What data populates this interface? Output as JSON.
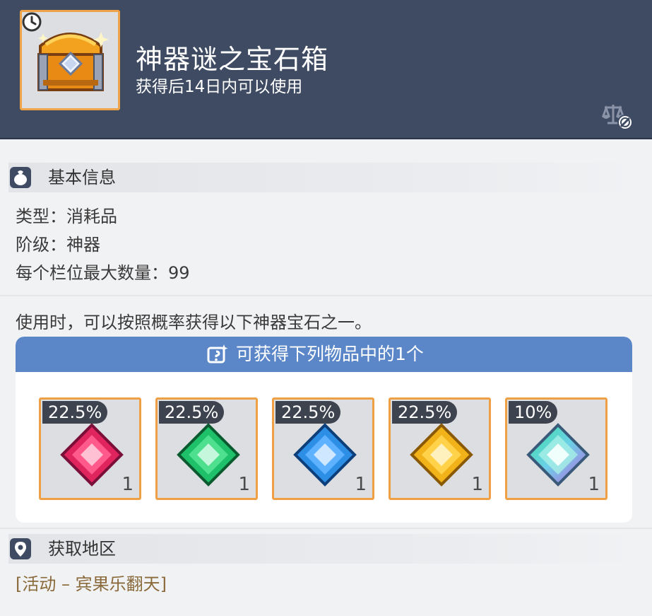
{
  "item": {
    "name": "神器谜之宝石箱",
    "expiry": "获得后14日内可以使用",
    "icon": "treasure-chest-icon",
    "badge_icon": "clock-icon",
    "trade_status_icon": "untradeable-scale-icon"
  },
  "basic_info": {
    "title": "基本信息",
    "icon": "money-bag-icon",
    "type_line": "类型：消耗品",
    "grade_line": "阶级：神器",
    "max_stack_line": "每个栏位最大数量：99"
  },
  "description": "使用时，可以按照概率获得以下神器宝石之一。",
  "rewards": {
    "title": "可获得下列物品中的1个",
    "icon": "random-box-icon",
    "items": [
      {
        "percent": "22.5%",
        "qty": "1",
        "gem": "red-gem-icon",
        "color": "#e0245e"
      },
      {
        "percent": "22.5%",
        "qty": "1",
        "gem": "green-gem-icon",
        "color": "#1fc06a"
      },
      {
        "percent": "22.5%",
        "qty": "1",
        "gem": "blue-gem-icon",
        "color": "#2d8ee6"
      },
      {
        "percent": "22.5%",
        "qty": "1",
        "gem": "yellow-gem-icon",
        "color": "#f2b21a"
      },
      {
        "percent": "10%",
        "qty": "1",
        "gem": "rainbow-gem-icon",
        "color": "#6ad0c8"
      }
    ]
  },
  "acquire": {
    "title": "获取地区",
    "icon": "map-pin-icon",
    "location": "[活动 – 宾果乐翻天]"
  },
  "colors": {
    "header_bg": "#3e4b62",
    "slot_border": "#f0a044",
    "reward_bar": "#5b87c9",
    "location_text": "#8a6a3a"
  }
}
